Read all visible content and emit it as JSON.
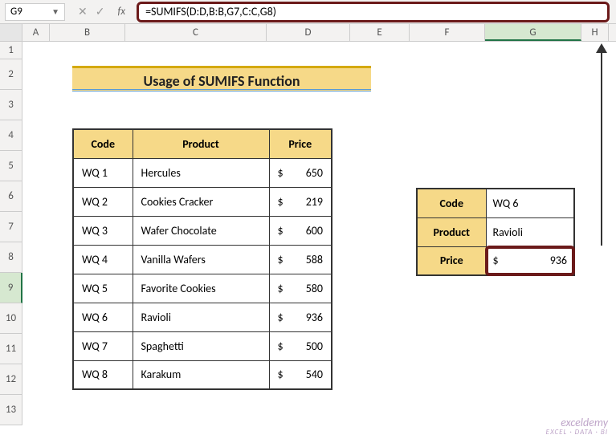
{
  "namebox": "G9",
  "formula": "=SUMIFS(D:D,B:B,G7,C:C,G8)",
  "fx": "fx",
  "title": "Usage of SUMIFS Function",
  "columns": [
    "A",
    "B",
    "C",
    "D",
    "E",
    "F",
    "G",
    "H"
  ],
  "rows": [
    "1",
    "2",
    "3",
    "4",
    "5",
    "6",
    "7",
    "8",
    "9",
    "10",
    "11",
    "12",
    "13"
  ],
  "headers": {
    "code": "Code",
    "product": "Product",
    "price": "Price"
  },
  "data": [
    {
      "code": "WQ 1",
      "product": "Hercules",
      "cur": "$",
      "price": "650"
    },
    {
      "code": "WQ 2",
      "product": "Cookies Cracker",
      "cur": "$",
      "price": "219"
    },
    {
      "code": "WQ 3",
      "product": "Wafer Chocolate",
      "cur": "$",
      "price": "600"
    },
    {
      "code": "WQ 4",
      "product": "Vanilla Wafers",
      "cur": "$",
      "price": "588"
    },
    {
      "code": "WQ 5",
      "product": "Favorite Cookies",
      "cur": "$",
      "price": "580"
    },
    {
      "code": "WQ 6",
      "product": "Ravioli",
      "cur": "$",
      "price": "936"
    },
    {
      "code": "WQ 7",
      "product": "Spaghetti",
      "cur": "$",
      "price": "500"
    },
    {
      "code": "WQ 8",
      "product": "Karakum",
      "cur": "$",
      "price": "540"
    }
  ],
  "lookup": {
    "code_label": "Code",
    "code_val": "WQ 6",
    "product_label": "Product",
    "product_val": "Ravioli",
    "price_label": "Price",
    "price_cur": "$",
    "price_val": "936"
  },
  "watermark": {
    "main": "exceldemy",
    "sub": "EXCEL · DATA · BI"
  }
}
